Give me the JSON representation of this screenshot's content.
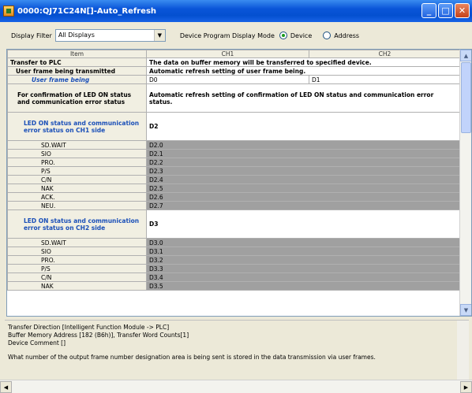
{
  "window": {
    "title": "0000:QJ71C24N[]-Auto_Refresh"
  },
  "filter": {
    "label": "Display Filter",
    "value": "All Displays"
  },
  "mode": {
    "label": "Device Program Display Mode",
    "options": [
      "Device",
      "Address"
    ],
    "selected": "Device"
  },
  "grid": {
    "headers": [
      "Item",
      "CH1",
      "CH2"
    ],
    "rows": [
      {
        "item": "Transfer to PLC",
        "ch1": "The data on buffer memory will be transferred to specified device.",
        "ch2": "",
        "style": "bold-group"
      },
      {
        "item": "User frame being transmitted",
        "ch1": "Automatic refresh setting of user frame being.",
        "ch2": "",
        "style": "bold-group2"
      },
      {
        "item": "User frame being",
        "ch1": "D0",
        "ch2": "D1",
        "style": "ital"
      },
      {
        "item": "For confirmation of LED ON status and communication error status",
        "ch1": "Automatic refresh setting of confirmation of LED ON status and communication error status.",
        "ch2": "",
        "style": "tall-bold"
      },
      {
        "item": "LED ON status and communication error status on CH1 side",
        "ch1": "D2",
        "ch2": "",
        "style": "tall-blue"
      },
      {
        "item": "SD.WAIT",
        "ch1": "D2.0",
        "ch2": "",
        "style": "gray"
      },
      {
        "item": "SIO",
        "ch1": "D2.1",
        "ch2": "",
        "style": "gray"
      },
      {
        "item": "PRO.",
        "ch1": "D2.2",
        "ch2": "",
        "style": "gray"
      },
      {
        "item": "P/S",
        "ch1": "D2.3",
        "ch2": "",
        "style": "gray"
      },
      {
        "item": "C/N",
        "ch1": "D2.4",
        "ch2": "",
        "style": "gray"
      },
      {
        "item": "NAK",
        "ch1": "D2.5",
        "ch2": "",
        "style": "gray"
      },
      {
        "item": "ACK.",
        "ch1": "D2.6",
        "ch2": "",
        "style": "gray"
      },
      {
        "item": "NEU.",
        "ch1": "D2.7",
        "ch2": "",
        "style": "gray"
      },
      {
        "item": "LED ON status and communication error status on CH2 side",
        "ch1": "D3",
        "ch2": "",
        "style": "tall-blue"
      },
      {
        "item": "SD.WAIT",
        "ch1": "D3.0",
        "ch2": "",
        "style": "gray"
      },
      {
        "item": "SIO",
        "ch1": "D3.1",
        "ch2": "",
        "style": "gray"
      },
      {
        "item": "PRO.",
        "ch1": "D3.2",
        "ch2": "",
        "style": "gray"
      },
      {
        "item": "P/S",
        "ch1": "D3.3",
        "ch2": "",
        "style": "gray"
      },
      {
        "item": "C/N",
        "ch1": "D3.4",
        "ch2": "",
        "style": "gray"
      },
      {
        "item": "NAK",
        "ch1": "D3.5",
        "ch2": "",
        "style": "gray"
      }
    ]
  },
  "info": {
    "line1": "Transfer Direction [Intelligent Function Module -> PLC]",
    "line2": "Buffer Memory Address [182 (B6h)], Transfer Word Counts[1]",
    "line3": "Device Comment []",
    "line4": "What number of the output frame number designation area is being sent is stored in the data transmission via user frames."
  }
}
